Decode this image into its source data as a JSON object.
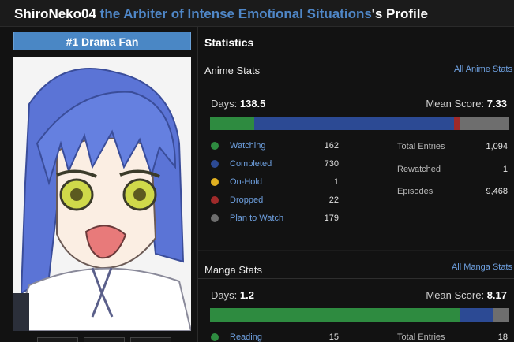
{
  "profile": {
    "username": "ShiroNeko04",
    "subtitle": "the Arbiter of Intense Emotional Situations",
    "suffix": "'s Profile",
    "badge": "#1 Drama Fan"
  },
  "stats": {
    "heading": "Statistics",
    "colors": {
      "watching": "#2e8b40",
      "completed": "#2c4a94",
      "on_hold": "#e0b020",
      "dropped": "#a02a2a",
      "plan": "#6e6e6e"
    },
    "anime": {
      "title": "Anime Stats",
      "link": "All Anime Stats",
      "days_label": "Days:",
      "days": "138.5",
      "mean_label": "Mean Score:",
      "mean": "7.33",
      "bar": [
        162,
        730,
        1,
        22,
        179
      ],
      "statuses": [
        {
          "label": "Watching",
          "count": "162",
          "color": "#2e8b40"
        },
        {
          "label": "Completed",
          "count": "730",
          "color": "#2c4a94"
        },
        {
          "label": "On-Hold",
          "count": "1",
          "color": "#e0b020"
        },
        {
          "label": "Dropped",
          "count": "22",
          "color": "#a02a2a"
        },
        {
          "label": "Plan to Watch",
          "count": "179",
          "color": "#6e6e6e"
        }
      ],
      "totals": [
        {
          "label": "Total Entries",
          "value": "1,094"
        },
        {
          "label": "Rewatched",
          "value": "1"
        },
        {
          "label": "Episodes",
          "value": "9,468"
        }
      ]
    },
    "manga": {
      "title": "Manga Stats",
      "link": "All Manga Stats",
      "days_label": "Days:",
      "days": "1.2",
      "mean_label": "Mean Score:",
      "mean": "8.17",
      "bar": [
        15,
        2,
        0,
        0,
        1
      ],
      "statuses": [
        {
          "label": "Reading",
          "count": "15",
          "color": "#2e8b40"
        }
      ],
      "totals": [
        {
          "label": "Total Entries",
          "value": "18"
        }
      ]
    }
  }
}
